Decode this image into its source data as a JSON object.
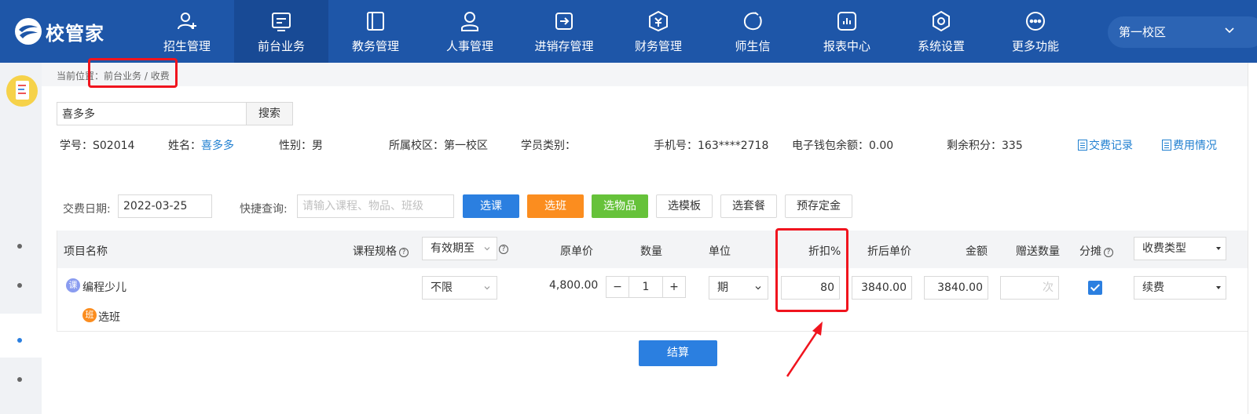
{
  "app": {
    "logo_text": "校管家"
  },
  "nav": [
    {
      "label": "招生管理",
      "icon": "user-add-icon"
    },
    {
      "label": "前台业务",
      "icon": "desk-icon",
      "active": true
    },
    {
      "label": "教务管理",
      "icon": "book-icon"
    },
    {
      "label": "人事管理",
      "icon": "person-icon"
    },
    {
      "label": "进销存管理",
      "icon": "inventory-icon"
    },
    {
      "label": "财务管理",
      "icon": "finance-icon"
    },
    {
      "label": "师生信",
      "icon": "message-icon"
    },
    {
      "label": "报表中心",
      "icon": "report-icon"
    },
    {
      "label": "系统设置",
      "icon": "settings-icon"
    },
    {
      "label": "更多功能",
      "icon": "more-icon"
    }
  ],
  "campus_selector": {
    "value": "第一校区"
  },
  "breadcrumb": {
    "prefix": "当前位置：",
    "path": "前台业务 / 收费"
  },
  "search": {
    "value": "喜多多",
    "button": "搜索"
  },
  "student": {
    "id_label": "学号：",
    "id": "S02014",
    "name_label": "姓名：",
    "name": "喜多多",
    "gender_label": "性别：",
    "gender": "男",
    "campus_label": "所属校区：",
    "campus": "第一校区",
    "type_label": "学员类别：",
    "type": "",
    "phone_label": "手机号：",
    "phone": "163****2718",
    "wallet_label": "电子钱包余额：",
    "wallet": "0.00",
    "points_label": "剩余积分：",
    "points": "335",
    "link_records": "交费记录",
    "link_fees": "费用情况"
  },
  "actions": {
    "date_label": "交费日期:",
    "date_value": "2022-03-25",
    "quick_label": "快捷查询:",
    "quick_placeholder": "请输入课程、物品、班级",
    "btn_course": "选课",
    "btn_class": "选班",
    "btn_goods": "选物品",
    "btn_template": "选模板",
    "btn_package": "选套餐",
    "btn_deposit": "预存定金"
  },
  "table": {
    "headers": {
      "item": "项目名称",
      "spec": "课程规格",
      "validity": "有效期至",
      "price": "原单价",
      "qty": "数量",
      "unit": "单位",
      "discount": "折扣%",
      "discount_price": "折后单价",
      "amount": "金额",
      "gift_qty": "赠送数量",
      "split": "分摊",
      "fee_type": "收费类型"
    },
    "row": {
      "course_badge": "课",
      "course_name": "编程少儿",
      "class_badge": "班",
      "class_action": "选班",
      "validity": "不限",
      "price": "4,800.00",
      "qty": "1",
      "unit": "期",
      "discount": "80",
      "discount_price": "3840.00",
      "amount": "3840.00",
      "gift_placeholder": "次",
      "split_checked": true,
      "fee_type": "续费"
    }
  },
  "submit": "结算",
  "colors": {
    "primary": "#1e56a8",
    "blue_button": "#2b7fe0",
    "orange_button": "#fb8d1f",
    "green_button": "#66c23a",
    "annotation": "#f0141e"
  }
}
